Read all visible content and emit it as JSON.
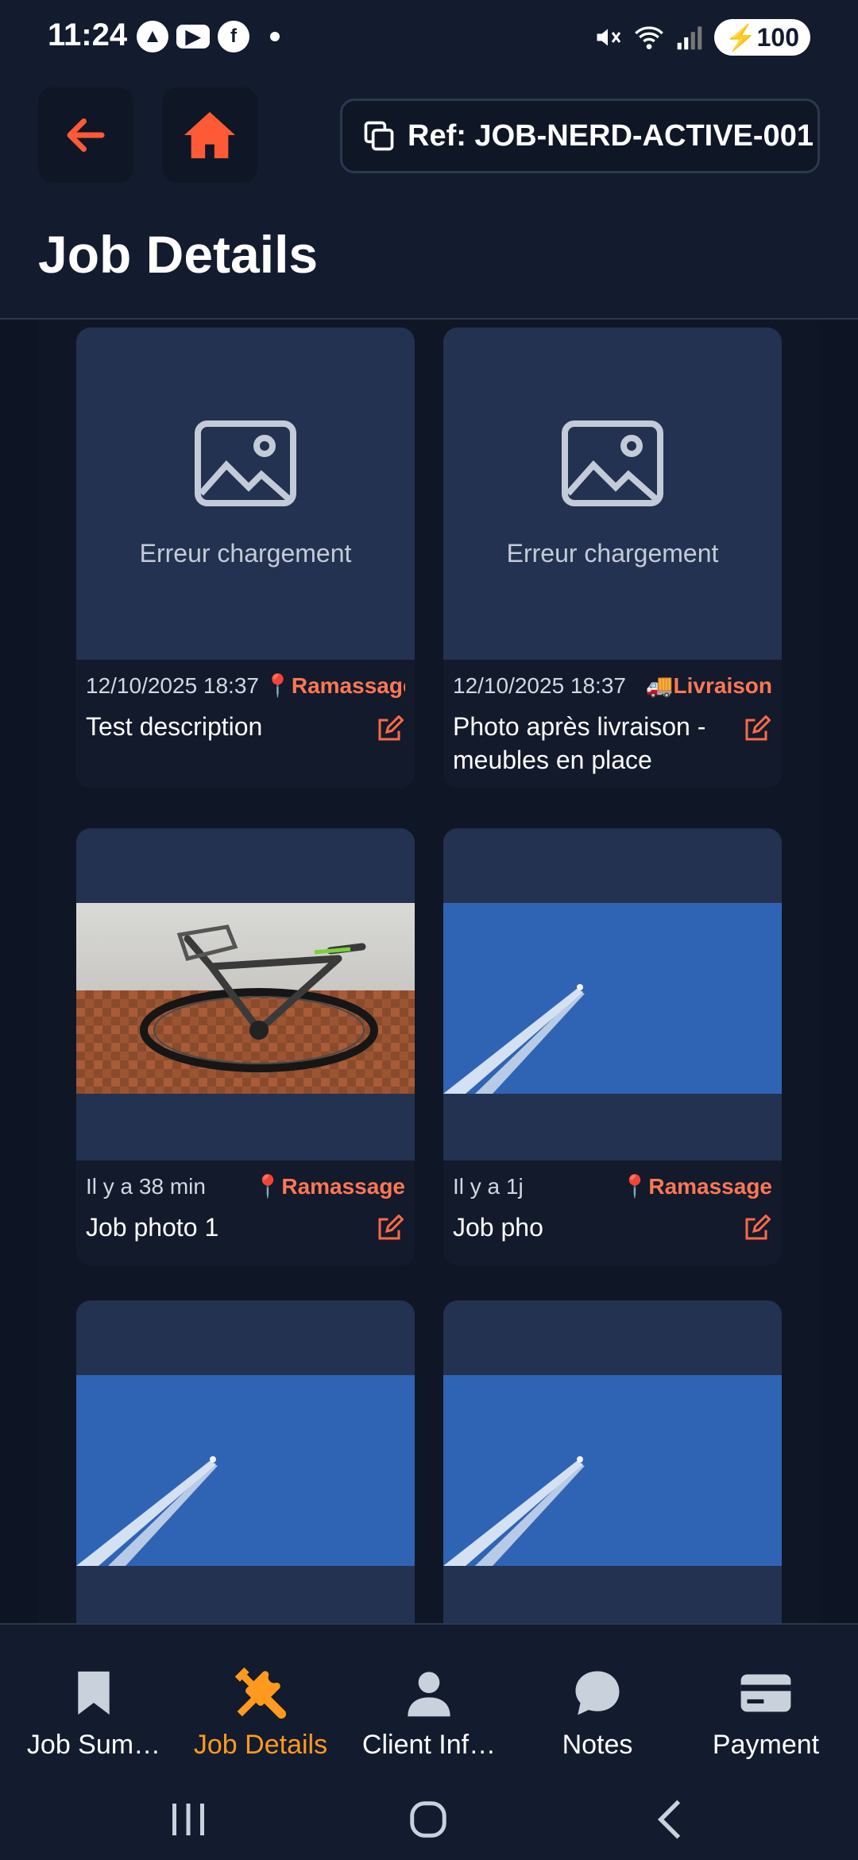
{
  "status_bar": {
    "time": "11:24",
    "battery": "100"
  },
  "header": {
    "ref_label": "Ref: JOB-NERD-ACTIVE-001",
    "title": "Job Details"
  },
  "photos": [
    {
      "error_text": "Erreur chargement",
      "date": "12/10/2025 18:37",
      "marker": "📍",
      "type": "Ramassage",
      "description": "Test description",
      "media": "error"
    },
    {
      "error_text": "Erreur chargement",
      "date": "12/10/2025 18:37",
      "marker": "🚚",
      "type": "Livraison",
      "description": "Photo après livraison - meubles en place",
      "media": "error"
    },
    {
      "date": "Il y a 38 min",
      "marker": "📍",
      "type": "Ramassage",
      "description": "Job photo 1",
      "media": "bicycle"
    },
    {
      "date": "Il y a 1j",
      "marker": "📍",
      "type": "Ramassage",
      "description": "Job pho",
      "media": "sky"
    },
    {
      "media": "sky"
    },
    {
      "media": "sky"
    }
  ],
  "bottom_nav": [
    {
      "label": "Job Sum…",
      "icon": "bookmark-icon"
    },
    {
      "label": "Job Details",
      "icon": "tools-icon",
      "active": true
    },
    {
      "label": "Client Inf…",
      "icon": "user-icon"
    },
    {
      "label": "Notes",
      "icon": "chat-icon"
    },
    {
      "label": "Payment",
      "icon": "credit-card-icon"
    }
  ],
  "colors": {
    "accent": "#ff5a36",
    "active_tab": "#ff9a1e",
    "tag": "#ff7755",
    "card_bg": "#233250"
  }
}
